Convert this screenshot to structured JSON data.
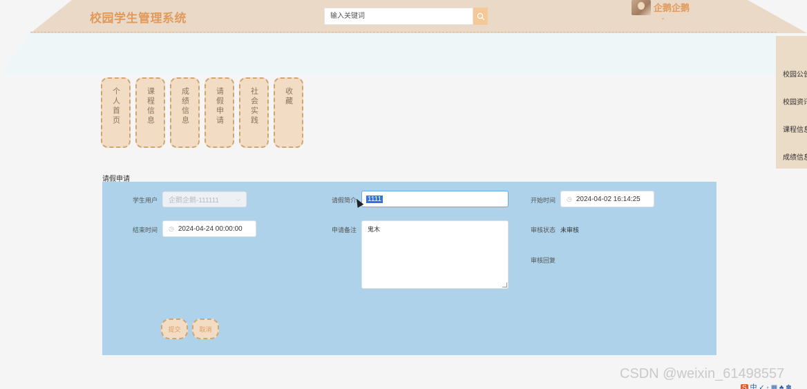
{
  "header": {
    "logo": "校园学生管理系统",
    "search_placeholder": "输入关键词",
    "search_icon": "search-icon",
    "username": "企鹅企鹅",
    "user_caret": "⌄"
  },
  "side_menu": {
    "items": [
      "校园公告",
      "校园资讯",
      "课程信息",
      "成绩信息"
    ]
  },
  "nav": {
    "tabs": [
      "个人首页",
      "课程信息",
      "成绩信息",
      "请假申请",
      "社会实践",
      "收藏"
    ]
  },
  "form": {
    "section_title": "请假申请",
    "student_user_label": "学生用户",
    "student_user_value": "企鹅企鹅-111111",
    "leave_intro_label": "请假简介",
    "leave_intro_value": "1111",
    "start_time_label": "开始时间",
    "start_time_value": "2024-04-02 16:14:25",
    "end_time_label": "结束时间",
    "end_time_value": "2024-04-24 00:00:00",
    "remark_label": "申请备注",
    "remark_value": "鬼木",
    "review_status_label": "审核状态",
    "review_status_value": "未审核",
    "review_reply_label": "审核回复",
    "submit_label": "提交",
    "cancel_label": "取消"
  },
  "colors": {
    "header_bg": "#ead9c6",
    "accent": "#e09a5c",
    "panel_bg": "#aed2ea",
    "tab_bg": "#f2dcc4"
  },
  "watermark": "CSDN @weixin_61498557"
}
